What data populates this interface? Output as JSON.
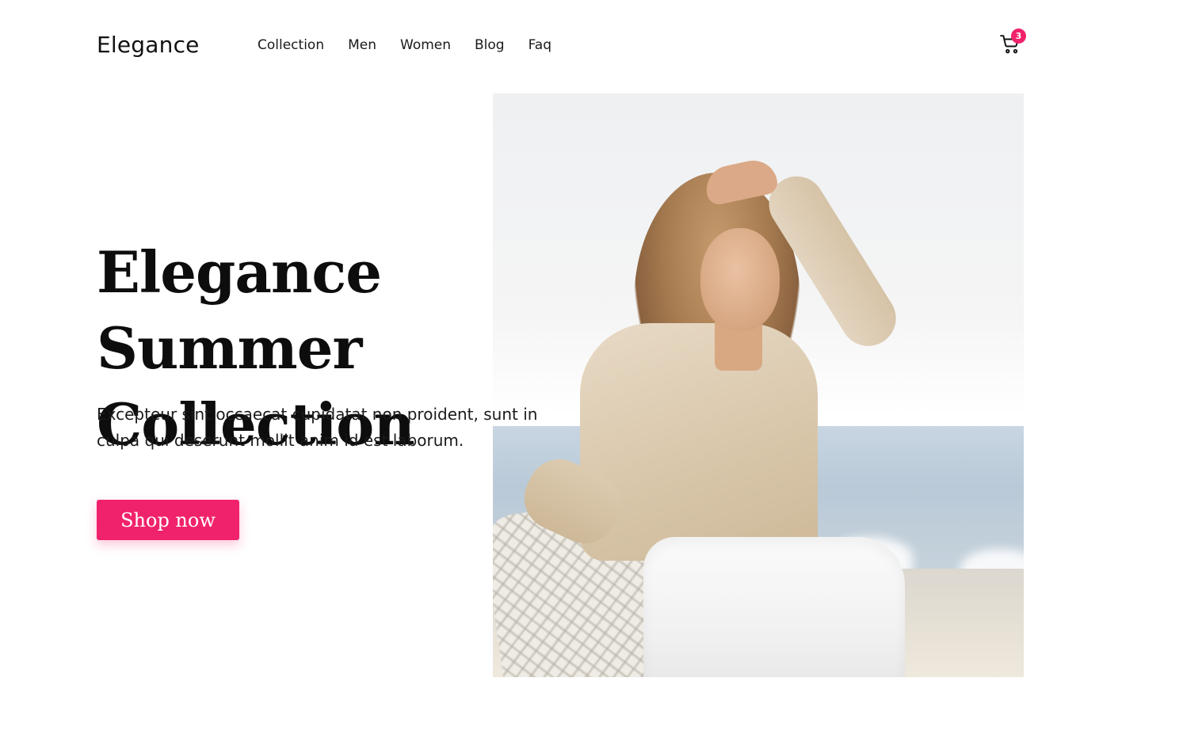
{
  "header": {
    "brand": "Elegance",
    "nav": [
      "Collection",
      "Men",
      "Women",
      "Blog",
      "Faq"
    ],
    "cart_count": "3"
  },
  "hero": {
    "title_line1": "Elegance Summer",
    "title_line2": "Collection",
    "description_line1": "Excepteur sint occaecat cupidatat non proident, sunt in",
    "description_line2": "culpa qui deserunt mollit anim id est laborum.",
    "cta_label": "Shop now"
  },
  "colors": {
    "accent": "#f0226b",
    "text": "#111111",
    "background": "#ffffff"
  },
  "icons": {
    "cart": "shopping-cart-icon"
  }
}
